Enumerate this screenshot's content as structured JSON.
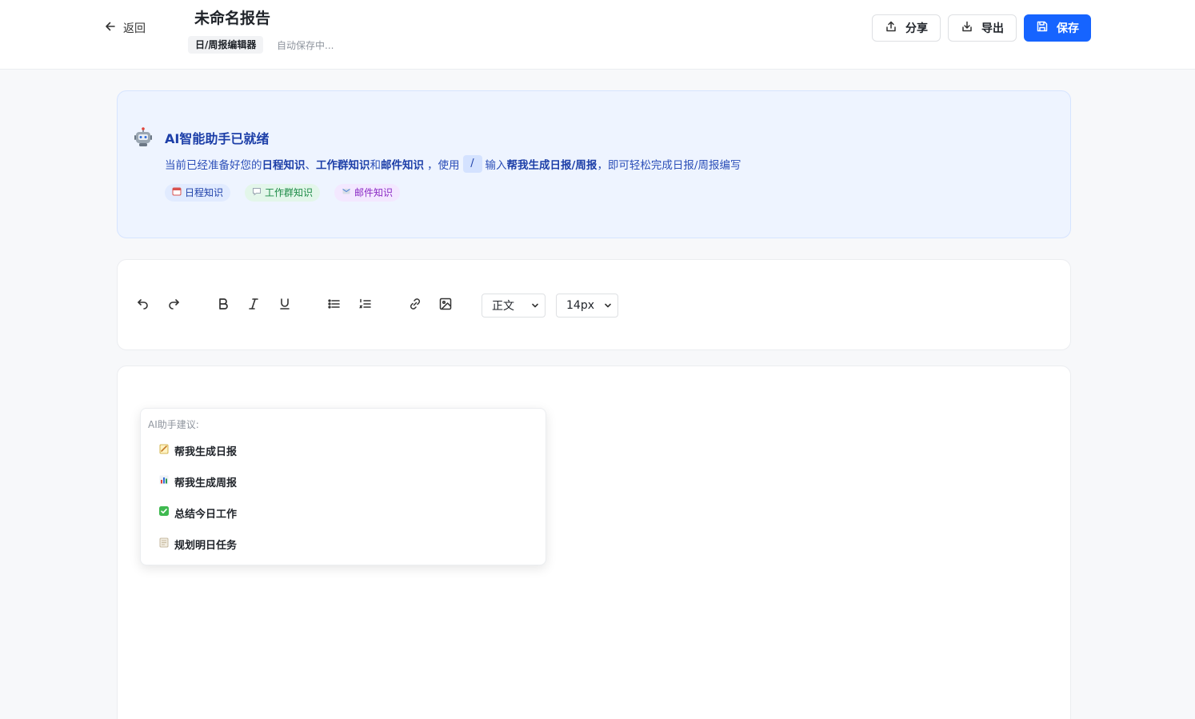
{
  "header": {
    "back_label": "返回",
    "title": "未命名报告",
    "editor_tag": "日/周报编辑器",
    "autosave": "自动保存中...",
    "share_label": "分享",
    "export_label": "导出",
    "save_label": "保存"
  },
  "ai_banner": {
    "title": "AI智能助手已就绪",
    "desc_1": "当前已经准备好您的",
    "desc_b1": "日程知识",
    "desc_2": "、",
    "desc_b2": "工作群知识",
    "desc_3": "和",
    "desc_b3": "邮件知识",
    "desc_4": "，使用",
    "desc_slash": "/",
    "desc_5": "输入",
    "desc_b4": "帮我生成日报/周报",
    "desc_6": "，即可轻松完成日报/周报编写",
    "chips": [
      {
        "label": "日程知识"
      },
      {
        "label": "工作群知识"
      },
      {
        "label": "邮件知识"
      }
    ]
  },
  "toolbar": {
    "style_select": "正文",
    "size_select": "14px"
  },
  "suggest": {
    "title": "AI助手建议:",
    "items": [
      {
        "label": "帮我生成日报",
        "icon": "memo-icon"
      },
      {
        "label": "帮我生成周报",
        "icon": "bar-chart-icon"
      },
      {
        "label": "总结今日工作",
        "icon": "check-box-icon"
      },
      {
        "label": "规划明日任务",
        "icon": "notepad-icon"
      }
    ]
  },
  "colors": {
    "primary": "#1664ff",
    "banner_bg": "#eef4ff",
    "banner_text": "#1d3fa8"
  }
}
